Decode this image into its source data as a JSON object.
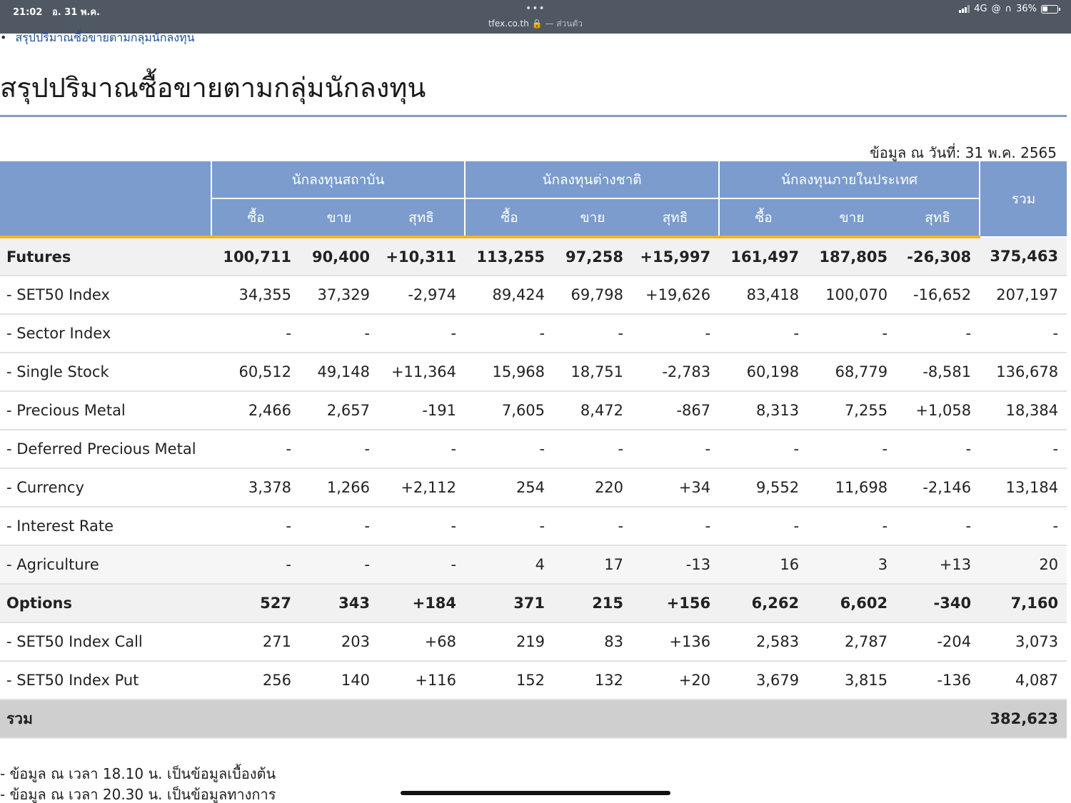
{
  "status_bar": {
    "time": "21:02",
    "date": "อ. 31 พ.ค.",
    "dots": "•••",
    "url": "tfex.co.th",
    "url_suffix": "— ส่วนตัว",
    "network": "4G",
    "battery": "36%"
  },
  "breadcrumb": {
    "text": "สรุปปริมาณซื้อขายตามกลุ่มนักลงทุน"
  },
  "page": {
    "title": "สรุปปริมาณซื้อขายตามกลุ่มนักลงทุน",
    "as_of": "ข้อมูล ณ วันที่: 31 พ.ค. 2565"
  },
  "table": {
    "groups": [
      "นักลงทุนสถาบัน",
      "นักลงทุนต่างชาติ",
      "นักลงทุนภายในประเทศ"
    ],
    "total_header": "รวม",
    "subheaders": [
      "ซื้อ",
      "ขาย",
      "สุทธิ",
      "ซื้อ",
      "ขาย",
      "สุทธิ",
      "ซื้อ",
      "ขาย",
      "สุทธิ"
    ],
    "rows": [
      {
        "kind": "group",
        "label": "Futures",
        "values": [
          "100,711",
          "90,400",
          "+10,311",
          "113,255",
          "97,258",
          "+15,997",
          "161,497",
          "187,805",
          "-26,308",
          "375,463"
        ]
      },
      {
        "kind": "sub",
        "label": "- SET50 Index",
        "values": [
          "34,355",
          "37,329",
          "-2,974",
          "89,424",
          "69,798",
          "+19,626",
          "83,418",
          "100,070",
          "-16,652",
          "207,197"
        ]
      },
      {
        "kind": "sub",
        "label": "- Sector Index",
        "values": [
          "-",
          "-",
          "-",
          "-",
          "-",
          "-",
          "-",
          "-",
          "-",
          "-"
        ]
      },
      {
        "kind": "sub",
        "label": "- Single Stock",
        "values": [
          "60,512",
          "49,148",
          "+11,364",
          "15,968",
          "18,751",
          "-2,783",
          "60,198",
          "68,779",
          "-8,581",
          "136,678"
        ]
      },
      {
        "kind": "sub",
        "label": "- Precious Metal",
        "values": [
          "2,466",
          "2,657",
          "-191",
          "7,605",
          "8,472",
          "-867",
          "8,313",
          "7,255",
          "+1,058",
          "18,384"
        ]
      },
      {
        "kind": "sub",
        "label": "- Deferred Precious Metal",
        "values": [
          "-",
          "-",
          "-",
          "-",
          "-",
          "-",
          "-",
          "-",
          "-",
          "-"
        ]
      },
      {
        "kind": "sub",
        "label": "- Currency",
        "values": [
          "3,378",
          "1,266",
          "+2,112",
          "254",
          "220",
          "+34",
          "9,552",
          "11,698",
          "-2,146",
          "13,184"
        ]
      },
      {
        "kind": "sub",
        "label": "- Interest Rate",
        "values": [
          "-",
          "-",
          "-",
          "-",
          "-",
          "-",
          "-",
          "-",
          "-",
          "-"
        ]
      },
      {
        "kind": "sub",
        "label": "- Agriculture",
        "values": [
          "-",
          "-",
          "-",
          "4",
          "17",
          "-13",
          "16",
          "3",
          "+13",
          "20"
        ]
      },
      {
        "kind": "group",
        "label": "Options",
        "values": [
          "527",
          "343",
          "+184",
          "371",
          "215",
          "+156",
          "6,262",
          "6,602",
          "-340",
          "7,160"
        ]
      },
      {
        "kind": "sub",
        "label": "- SET50 Index Call",
        "values": [
          "271",
          "203",
          "+68",
          "219",
          "83",
          "+136",
          "2,583",
          "2,787",
          "-204",
          "3,073"
        ]
      },
      {
        "kind": "sub",
        "label": "- SET50 Index Put",
        "values": [
          "256",
          "140",
          "+116",
          "152",
          "132",
          "+20",
          "3,679",
          "3,815",
          "-136",
          "4,087"
        ]
      }
    ],
    "grand_total": {
      "label": "รวม",
      "value": "382,623"
    }
  },
  "notes": [
    "- ข้อมูล ณ เวลา 18.10 น. เป็นข้อมูลเบื้องต้น",
    "- ข้อมูล ณ เวลา 20.30 น. เป็นข้อมูลทางการ"
  ],
  "colors": {
    "header_bg": "#7b9ccd",
    "accent_line": "#f2b51e",
    "positive": "#1a8a1a",
    "negative": "#e01b1b",
    "link": "#1f4e99"
  }
}
